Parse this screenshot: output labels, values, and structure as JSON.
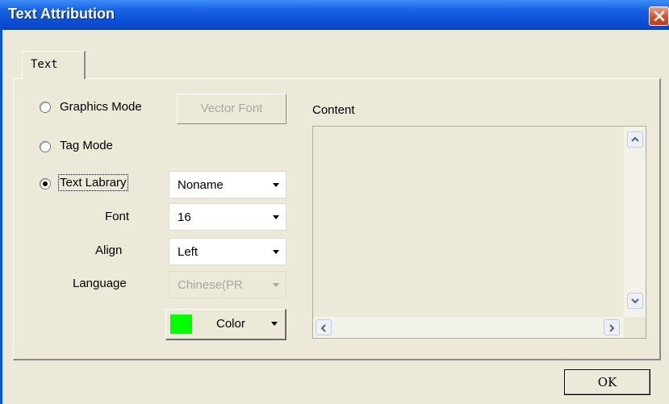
{
  "window": {
    "title": "Text Attribution",
    "close_icon": "close-icon"
  },
  "tabs": [
    {
      "label": "Text",
      "selected": true
    }
  ],
  "modes": {
    "graphics_mode": {
      "label": "Graphics Mode",
      "checked": false
    },
    "tag_mode": {
      "label": "Tag Mode",
      "checked": false
    },
    "text_library": {
      "label": "Text Labrary",
      "checked": true
    }
  },
  "vector_font_button": {
    "label": "Vector Font",
    "enabled": false
  },
  "text_library_select": {
    "value": "Noname"
  },
  "font": {
    "label": "Font",
    "value": "16"
  },
  "align": {
    "label": "Align",
    "value": "Left"
  },
  "language": {
    "label": "Language",
    "value": "Chinese(PR",
    "enabled": false
  },
  "color_button": {
    "label": "Color",
    "swatch_color": "#00ff00"
  },
  "content": {
    "label": "Content",
    "text": ""
  },
  "ok_button": {
    "label": "OK"
  }
}
